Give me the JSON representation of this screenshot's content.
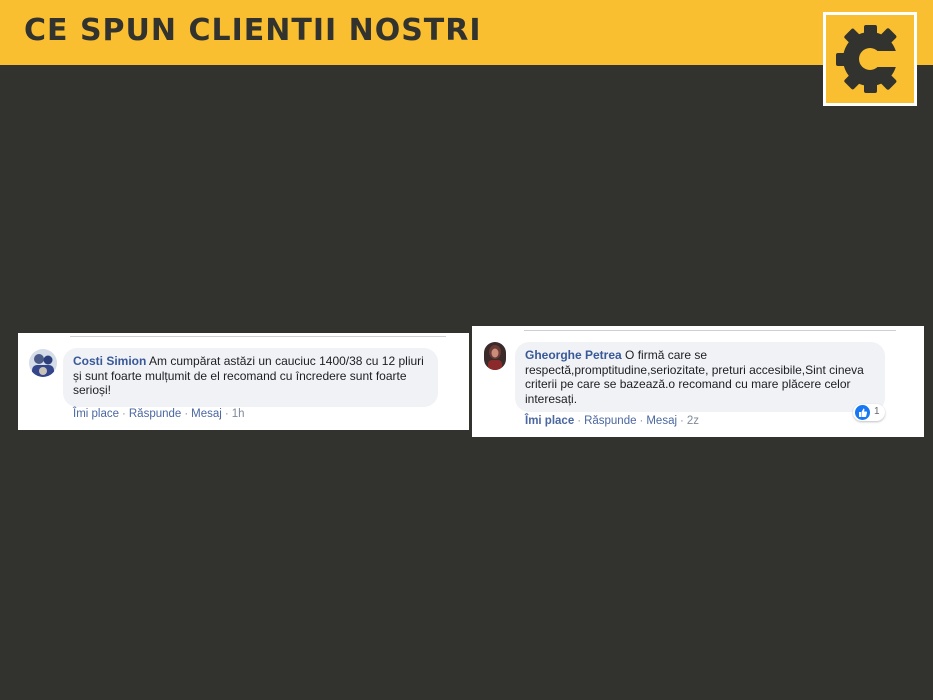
{
  "header": {
    "title": "CE SPUN CLIENTII NOSTRI",
    "background": "#f9bf30",
    "text_color": "#32332e"
  },
  "logo": {
    "icon": "gear-c-logo",
    "letter": "C"
  },
  "page": {
    "background": "#32332e"
  },
  "comments": [
    {
      "author": "Costi Simion",
      "text": "Am cumpărat astăzi un cauciuc 1400/38 cu 12 pliuri și sunt foarte mulțumit de el recomand cu încredere sunt foarte serioși!",
      "actions": {
        "like": "Îmi place",
        "reply": "Răspunde",
        "message": "Mesaj",
        "time": "1h"
      }
    },
    {
      "author": "Gheorghe Petrea",
      "text": "O firmă care se respectă,promptitudine,seriozitate, preturi accesibile,Sint cineva criterii pe care se bazează.o recomand cu mare plăcere celor interesați.",
      "actions": {
        "like": "Îmi place",
        "reply": "Răspunde",
        "message": "Mesaj",
        "time": "2z"
      },
      "reactions": {
        "icon": "like-icon",
        "count": "1"
      }
    }
  ]
}
